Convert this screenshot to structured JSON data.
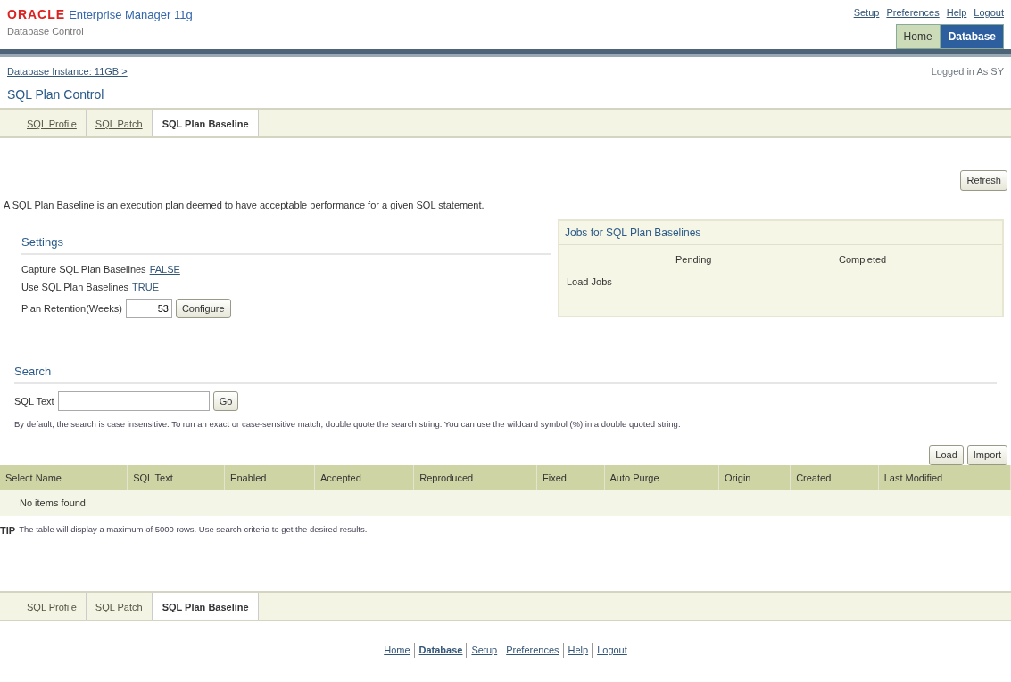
{
  "header": {
    "logo": "ORACLE",
    "product": "Enterprise Manager 11g",
    "subtitle": "Database Control",
    "links": [
      "Setup",
      "Preferences",
      "Help",
      "Logout"
    ],
    "global_tabs": [
      {
        "label": "Home",
        "selected": false
      },
      {
        "label": "Database",
        "selected": true
      }
    ]
  },
  "breadcrumb": "Database Instance: 11GB >",
  "login": "Logged in As SY",
  "page_title": "SQL Plan Control",
  "tabs": [
    {
      "label": "SQL Profile",
      "selected": false
    },
    {
      "label": "SQL Patch",
      "selected": false
    },
    {
      "label": "SQL Plan Baseline",
      "selected": true
    }
  ],
  "refresh_button": "Refresh",
  "description": "A SQL Plan Baseline is an execution plan deemed to have acceptable performance for a given SQL statement.",
  "settings": {
    "title": "Settings",
    "rows": [
      {
        "label": "Capture SQL Plan Baselines",
        "value": "FALSE"
      },
      {
        "label": "Use SQL Plan Baselines",
        "value": "TRUE"
      }
    ],
    "retention": {
      "label": "Plan Retention(Weeks)",
      "value": "53",
      "button": "Configure"
    }
  },
  "jobs": {
    "title": "Jobs for SQL Plan Baselines",
    "columns": [
      "Pending",
      "Completed"
    ],
    "rows": [
      "Load Jobs"
    ]
  },
  "search": {
    "title": "Search",
    "label": "SQL Text",
    "button": "Go",
    "hint": "By default, the search is case insensitive. To run an exact or case-sensitive match, double quote the search string. You can use the wildcard symbol (%) in a double quoted string."
  },
  "table": {
    "buttons": [
      "Load",
      "Import"
    ],
    "columns": [
      "Select Name",
      "SQL Text",
      "Enabled",
      "Accepted",
      "Reproduced",
      "Fixed",
      "Auto Purge",
      "Origin",
      "Created",
      "Last Modified"
    ],
    "empty": "No items found"
  },
  "tip": {
    "label": "TIP",
    "text": "The table will display a maximum of 5000 rows. Use search criteria to get the desired results."
  },
  "bottom_tabs": [
    {
      "label": "SQL Profile",
      "selected": false
    },
    {
      "label": "SQL Patch",
      "selected": false
    },
    {
      "label": "SQL Plan Baseline",
      "selected": true
    }
  ],
  "footer": [
    "Home",
    "Database",
    "Setup",
    "Preferences",
    "Help",
    "Logout"
  ]
}
